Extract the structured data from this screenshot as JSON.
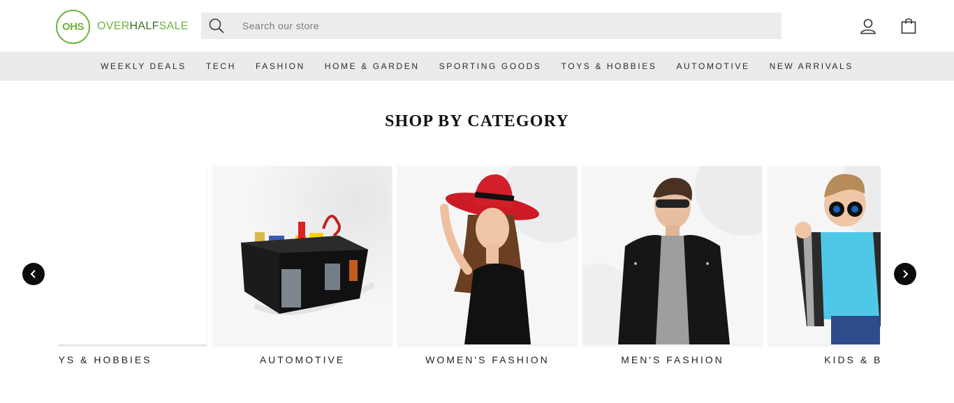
{
  "brand": {
    "mark": "OHS",
    "name_part1": "OVER",
    "name_part2": "HALF",
    "name_part3": "SALE",
    "colors": {
      "light_green": "#6cb33e",
      "dark_green": "#3a6f1d"
    }
  },
  "search": {
    "placeholder": "Search our store",
    "value": "",
    "icon": "search-icon"
  },
  "header_icons": {
    "account": "user-icon",
    "cart": "shopping-bag-icon"
  },
  "nav": {
    "items": [
      {
        "label": "WEEKLY DEALS"
      },
      {
        "label": "TECH"
      },
      {
        "label": "FASHION"
      },
      {
        "label": "HOME & GARDEN"
      },
      {
        "label": "SPORTING GOODS"
      },
      {
        "label": "TOYS & HOBBIES"
      },
      {
        "label": "AUTOMOTIVE"
      },
      {
        "label": "NEW ARRIVALS"
      }
    ]
  },
  "section": {
    "title": "SHOP BY CATEGORY"
  },
  "categories": [
    {
      "label": "TOYS & HOBBIES"
    },
    {
      "label": "AUTOMOTIVE"
    },
    {
      "label": "WOMEN'S FASHION"
    },
    {
      "label": "MEN'S FASHION"
    },
    {
      "label": "KIDS & BA"
    }
  ],
  "carousel": {
    "prev_icon": "chevron-left-icon",
    "next_icon": "chevron-right-icon"
  }
}
